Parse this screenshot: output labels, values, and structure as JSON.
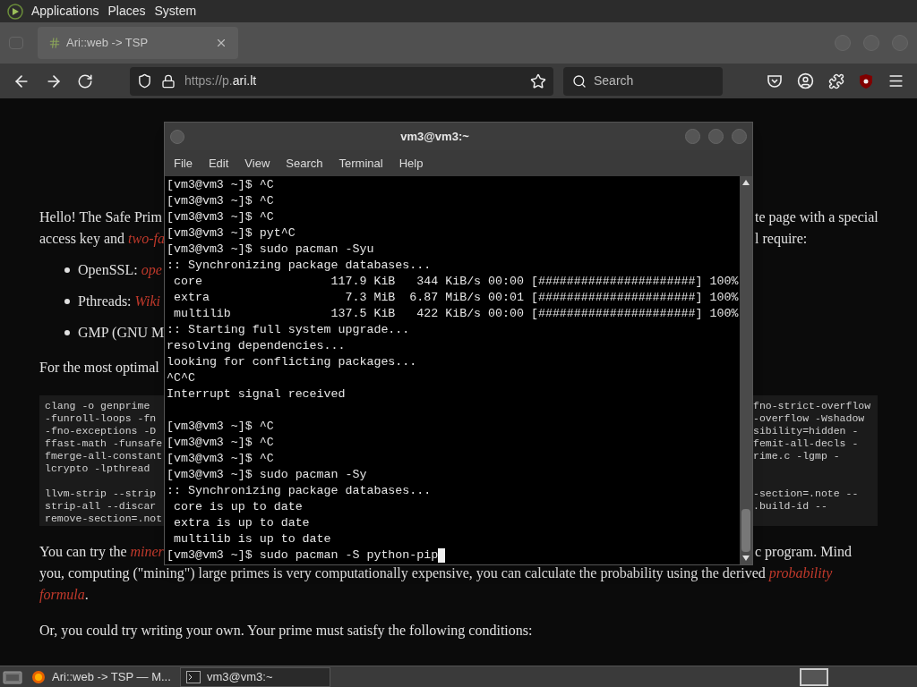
{
  "top_panel": {
    "menus": [
      "Applications",
      "Places",
      "System"
    ]
  },
  "browser": {
    "tabs": [
      {
        "title": "Ari::web -> TSP",
        "selected": true
      }
    ],
    "url": {
      "prefix": "https://p.",
      "domain": "ari.lt"
    },
    "search": {
      "placeholder": "Search"
    }
  },
  "page": {
    "intro": [
      {
        "left": [
          {
            "kind": "text",
            "text": "Hello! The Safe Prim"
          }
        ],
        "right": "te page with a special"
      },
      {
        "left": [
          {
            "kind": "text",
            "text": "access key and "
          },
          {
            "kind": "link",
            "text": "two-fa"
          }
        ],
        "right": "l require:"
      }
    ],
    "bullets": [
      [
        {
          "kind": "text",
          "text": "OpenSSL: "
        },
        {
          "kind": "link",
          "text": "ope"
        }
      ],
      [
        {
          "kind": "text",
          "text": "Pthreads: "
        },
        {
          "kind": "link",
          "text": "Wiki"
        }
      ],
      [
        {
          "kind": "text",
          "text": "GMP (GNU M"
        }
      ]
    ],
    "optimal": "For the most optimal",
    "code_rows": [
      {
        "left": "clang -o genprime",
        "right": "fno-strict-overflow"
      },
      {
        "left": "-funroll-loops -fn",
        "right": "-overflow -Wshadow"
      },
      {
        "left": "-fno-exceptions -D",
        "right": "sibility=hidden -"
      },
      {
        "left": "ffast-math -funsafe",
        "right": "femit-all-decls -"
      },
      {
        "left": "fmerge-all-constant",
        "right": "rime.c -lgmp -"
      },
      {
        "left": "lcrypto -lpthread",
        "blank_after": true
      },
      {
        "left": "llvm-strip --strip",
        "right": "-section=.note --"
      },
      {
        "left": "strip-all --discar",
        "right": ".build-id --"
      },
      {
        "left": "remove-section=.not"
      }
    ],
    "miner_line": {
      "left": [
        {
          "kind": "text",
          "text": "You can try the "
        },
        {
          "kind": "link",
          "text": "miner"
        }
      ],
      "right": "c program. Mind"
    },
    "lines": [
      [
        {
          "kind": "text",
          "text": "you, computing (\"mining\") large primes is very computationally expensive, you can calculate the probability using the derived "
        },
        {
          "kind": "link",
          "text": "probability"
        }
      ],
      [
        {
          "kind": "link",
          "text": "formula"
        },
        {
          "kind": "text",
          "text": "."
        }
      ]
    ],
    "conditions": "Or, you could try writing your own. Your prime must satisfy the following conditions:"
  },
  "terminal": {
    "title": "vm3@vm3:~",
    "menus": [
      "File",
      "Edit",
      "View",
      "Search",
      "Terminal",
      "Help"
    ],
    "lines": [
      {
        "text": "[vm3@vm3 ~]$ ^C"
      },
      {
        "text": "[vm3@vm3 ~]$ ^C"
      },
      {
        "text": "[vm3@vm3 ~]$ ^C"
      },
      {
        "text": "[vm3@vm3 ~]$ pyt^C"
      },
      {
        "text": "[vm3@vm3 ~]$ sudo pacman -Syu"
      },
      {
        "text": ":: Synchronizing package databases..."
      },
      {
        "text": " core                  117.9 KiB   344 KiB/s 00:00 [######################] 100%"
      },
      {
        "text": " extra                   7.3 MiB  6.87 MiB/s 00:01 [######################] 100%"
      },
      {
        "text": " multilib              137.5 KiB   422 KiB/s 00:00 [######################] 100%"
      },
      {
        "text": ":: Starting full system upgrade..."
      },
      {
        "text": "resolving dependencies..."
      },
      {
        "text": "looking for conflicting packages..."
      },
      {
        "text": "^C^C"
      },
      {
        "text": "Interrupt signal received",
        "blank_after": true
      },
      {
        "text": "[vm3@vm3 ~]$ ^C"
      },
      {
        "text": "[vm3@vm3 ~]$ ^C"
      },
      {
        "text": "[vm3@vm3 ~]$ ^C"
      },
      {
        "text": "[vm3@vm3 ~]$ sudo pacman -Sy"
      },
      {
        "text": ":: Synchronizing package databases..."
      },
      {
        "text": " core is up to date"
      },
      {
        "text": " extra is up to date"
      },
      {
        "text": " multilib is up to date"
      },
      {
        "text": "[vm3@vm3 ~]$ sudo pacman -S python-pip",
        "cursor": true
      }
    ]
  },
  "taskbar": {
    "items": [
      {
        "kind": "browser",
        "label": "Ari::web -> TSP — M...",
        "selected": false
      },
      {
        "kind": "terminal",
        "label": "vm3@vm3:~",
        "selected": true
      }
    ]
  }
}
